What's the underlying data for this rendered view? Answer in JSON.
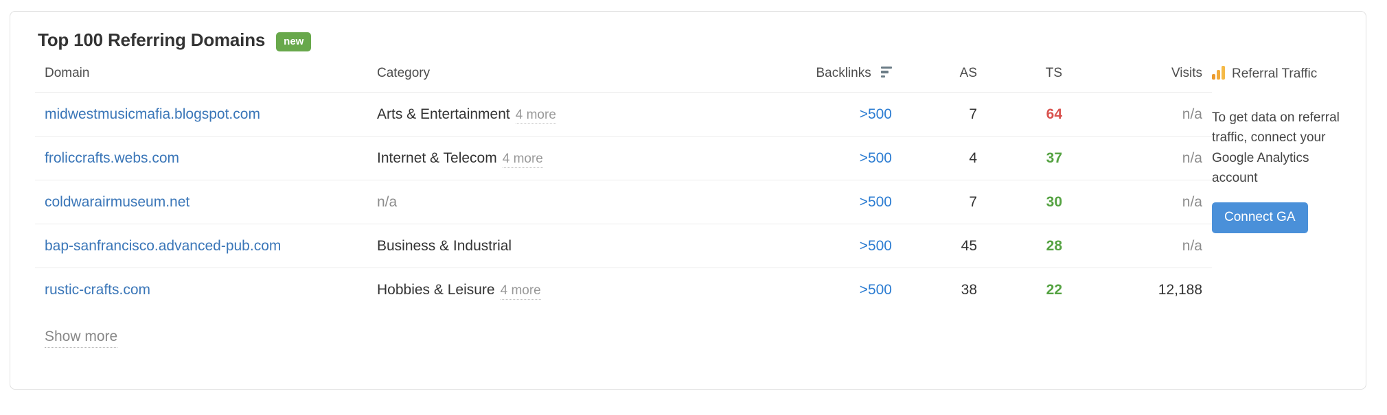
{
  "card": {
    "title": "Top 100 Referring Domains",
    "badge": "new"
  },
  "table": {
    "headers": {
      "domain": "Domain",
      "category": "Category",
      "backlinks": "Backlinks",
      "as": "AS",
      "ts": "TS",
      "visits": "Visits",
      "referral_traffic": "Referral Traffic"
    },
    "sort_icon": "sort-descending-icon",
    "referral_icon": "google-analytics-bars-icon",
    "rows": [
      {
        "domain": "midwestmusicmafia.blogspot.com",
        "category": "Arts & Entertainment",
        "category_more": "4 more",
        "backlinks": ">500",
        "as": "7",
        "ts": "64",
        "ts_level": "high",
        "visits": "n/a"
      },
      {
        "domain": "froliccrafts.webs.com",
        "category": "Internet & Telecom",
        "category_more": "4 more",
        "backlinks": ">500",
        "as": "4",
        "ts": "37",
        "ts_level": "ok",
        "visits": "n/a"
      },
      {
        "domain": "coldwarairmuseum.net",
        "category": "n/a",
        "category_more": "",
        "backlinks": ">500",
        "as": "7",
        "ts": "30",
        "ts_level": "ok",
        "visits": "n/a"
      },
      {
        "domain": "bap-sanfrancisco.advanced-pub.com",
        "category": "Business & Industrial",
        "category_more": "",
        "backlinks": ">500",
        "as": "45",
        "ts": "28",
        "ts_level": "ok",
        "visits": "n/a"
      },
      {
        "domain": "rustic-crafts.com",
        "category": "Hobbies & Leisure",
        "category_more": "4 more",
        "backlinks": ">500",
        "as": "38",
        "ts": "22",
        "ts_level": "ok",
        "visits": "12,188"
      }
    ]
  },
  "referral_panel": {
    "text": "To get data on referral traffic, connect your Google Analytics account",
    "button": "Connect GA"
  },
  "footer": {
    "show_more": "Show more"
  },
  "colors": {
    "link": "#3a76b8",
    "backlink_link": "#2d7dd2",
    "badge_green": "#68a84b",
    "ts_high": "#d9534f",
    "ts_ok": "#54a241",
    "button_blue": "#4a90d9",
    "ga_orange": "#f2ab3c",
    "muted": "#8c8c8c"
  }
}
